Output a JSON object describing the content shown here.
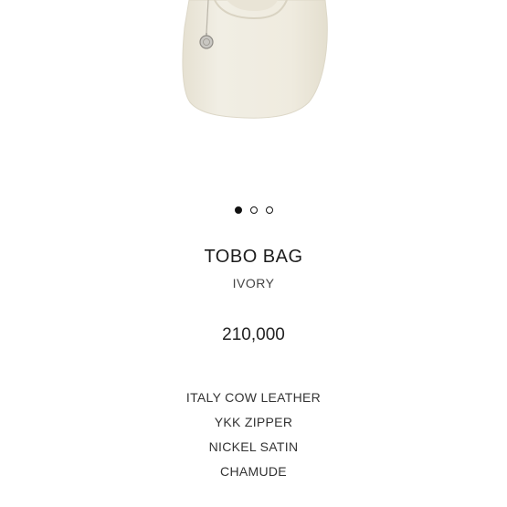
{
  "product": {
    "name": "TOBO BAG",
    "color": "IVORY",
    "price": "210,000",
    "specs": [
      "ITALY COW LEATHER",
      "YKK ZIPPER",
      "NICKEL SATIN",
      "CHAMUDE"
    ]
  },
  "carousel": {
    "dots": 3,
    "active_index": 0
  },
  "colors": {
    "bag": "#efebdf",
    "text": "#222222",
    "dot": "#111111"
  }
}
